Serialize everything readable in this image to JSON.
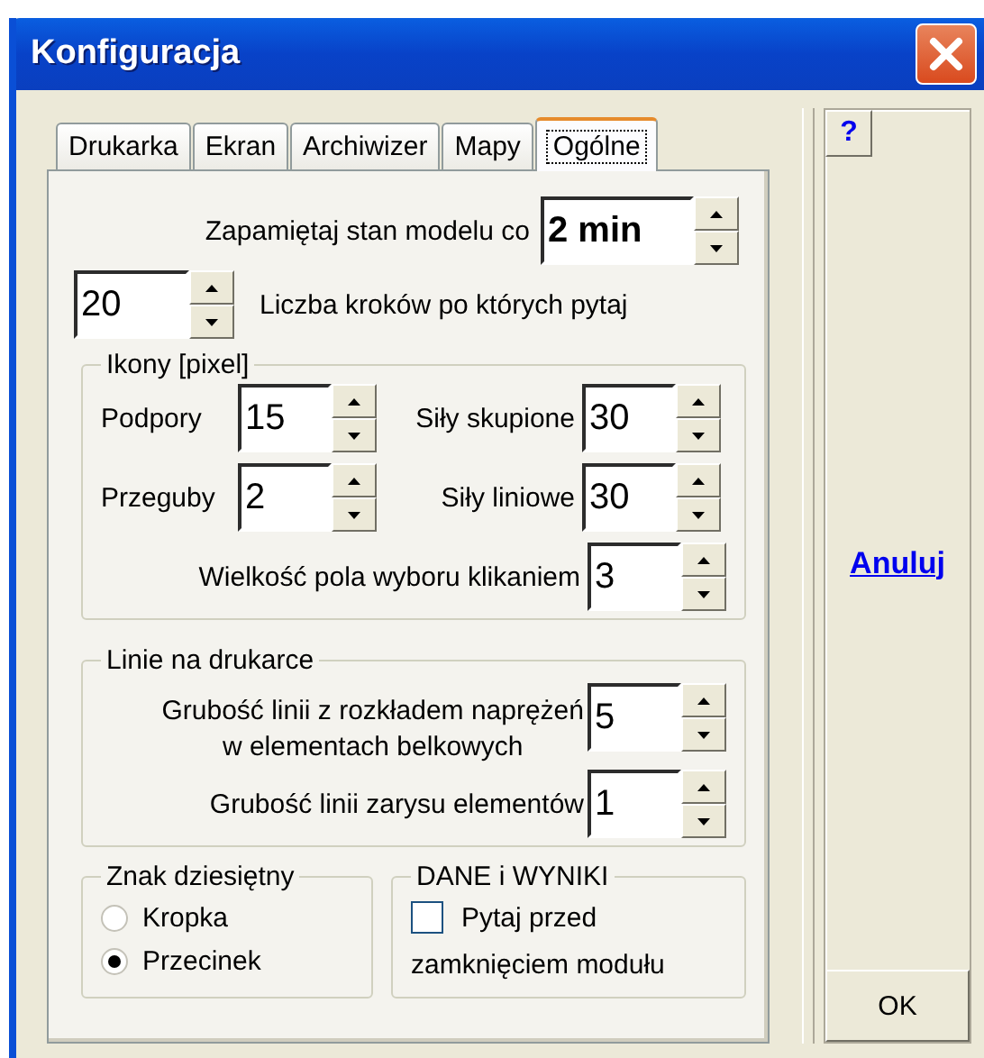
{
  "window": {
    "title": "Konfiguracja"
  },
  "tabs": [
    {
      "label": "Drukarka",
      "selected": false
    },
    {
      "label": "Ekran",
      "selected": false
    },
    {
      "label": "Archiwizer",
      "selected": false
    },
    {
      "label": "Mapy",
      "selected": false
    },
    {
      "label": "Ogólne",
      "selected": true
    }
  ],
  "autosave": {
    "label": "Zapamiętaj stan modelu co",
    "value": "2 min"
  },
  "steps": {
    "value": "20",
    "label": "Liczba kroków po których pytaj"
  },
  "icons_group": {
    "title": "Ikony [pixel]",
    "fields": [
      {
        "label": "Podpory",
        "value": "15"
      },
      {
        "label": "Siły skupione",
        "value": "30"
      },
      {
        "label": "Przeguby",
        "value": "2"
      },
      {
        "label": "Siły liniowe",
        "value": "30"
      }
    ],
    "pick": {
      "label": "Wielkość pola wyboru klikaniem",
      "value": "3"
    }
  },
  "printer_lines": {
    "title": "Linie na drukarce",
    "fields": [
      {
        "label": "Grubość linii z rozkładem naprężeń\nw elementach belkowych",
        "value": "5"
      },
      {
        "label": "Grubość linii zarysu elementów",
        "value": "1"
      }
    ]
  },
  "decimal": {
    "title": "Znak dziesiętny",
    "options": [
      {
        "label": "Kropka",
        "selected": false
      },
      {
        "label": "Przecinek",
        "selected": true
      }
    ]
  },
  "data_results": {
    "title": "DANE i WYNIKI",
    "checkbox": {
      "label": "Pytaj przed zamknięciem modułu",
      "checked": false
    }
  },
  "help_button": "?",
  "cancel_link": "Anuluj",
  "ok_button": "OK"
}
